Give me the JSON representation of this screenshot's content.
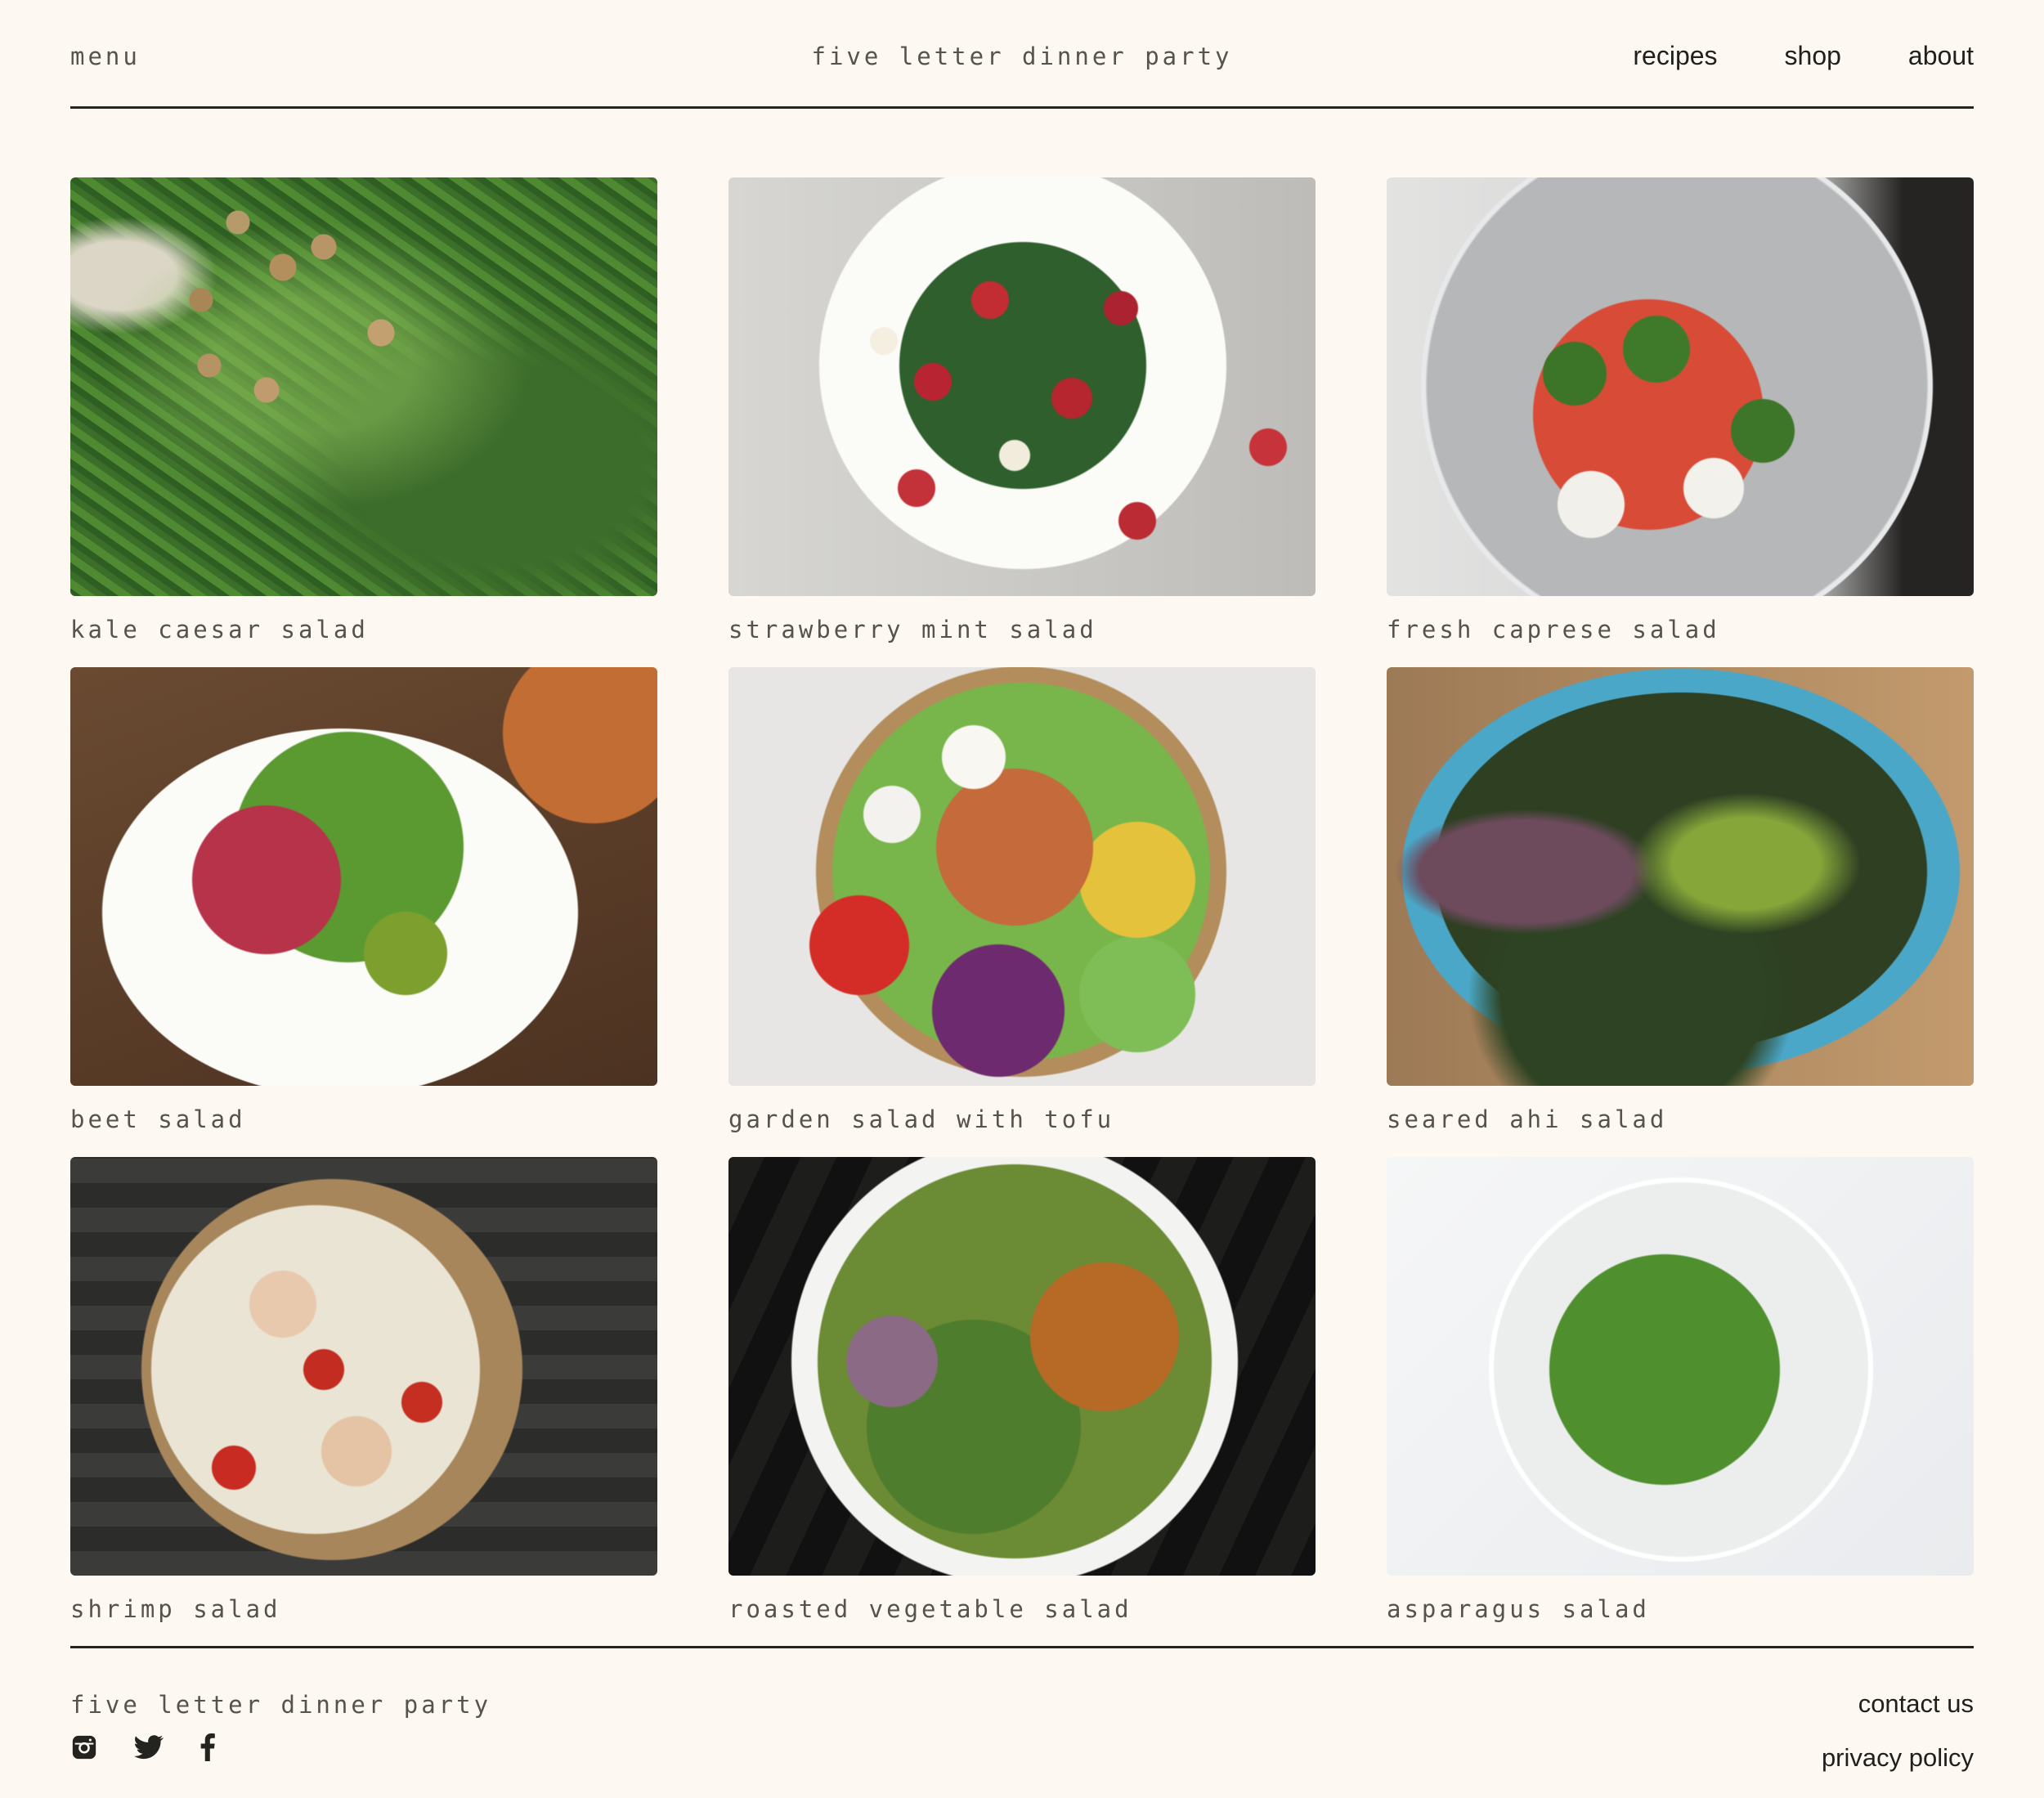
{
  "header": {
    "menu_label": "menu",
    "site_title": "five letter dinner party",
    "nav": [
      "recipes",
      "shop",
      "about"
    ]
  },
  "recipes": [
    {
      "title": "kale caesar salad"
    },
    {
      "title": "strawberry mint salad"
    },
    {
      "title": "fresh caprese salad"
    },
    {
      "title": "beet salad"
    },
    {
      "title": "garden salad with tofu"
    },
    {
      "title": "seared ahi salad"
    },
    {
      "title": "shrimp salad"
    },
    {
      "title": "roasted vegetable salad"
    },
    {
      "title": "asparagus salad"
    }
  ],
  "footer": {
    "site_title": "five letter dinner party",
    "links": [
      "contact us",
      "privacy policy"
    ],
    "socials": [
      "instagram-icon",
      "twitter-icon",
      "facebook-icon"
    ]
  },
  "colors": {
    "background": "#fdf9f2",
    "rule": "#23231f",
    "text": "#55534d"
  }
}
